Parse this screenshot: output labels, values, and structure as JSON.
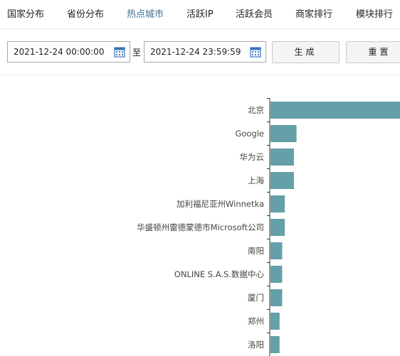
{
  "tabs": [
    {
      "label": "国家分布"
    },
    {
      "label": "省份分布"
    },
    {
      "label": "热点城市"
    },
    {
      "label": "活跃IP"
    },
    {
      "label": "活跃会员"
    },
    {
      "label": "商家排行"
    },
    {
      "label": "模块排行"
    }
  ],
  "active_tab": "热点城市",
  "filters": {
    "start_datetime": "2021-12-24 00:00:00",
    "separator": "至",
    "end_datetime": "2021-12-24 23:59:59",
    "generate_label": "生成",
    "reset_label": "重置",
    "calendar_icon": "calendar-icon"
  },
  "colors": {
    "bar": "#659fa8",
    "active_tab": "#3d6f94"
  },
  "chart_data": {
    "type": "bar",
    "orientation": "horizontal",
    "categories": [
      "北京",
      "Google",
      "华为云",
      "上海",
      "加利福尼亚州Winnetka",
      "华盛顿州雷德蒙德市Microsoft公司",
      "南阳",
      "ONLINE S.A.S.数据中心",
      "厦门",
      "郑州",
      "洛阳"
    ],
    "values": [
      100,
      20,
      18,
      18,
      11,
      11,
      9,
      9,
      9,
      7,
      7
    ],
    "xlim": [
      0,
      100
    ],
    "grid": false
  }
}
